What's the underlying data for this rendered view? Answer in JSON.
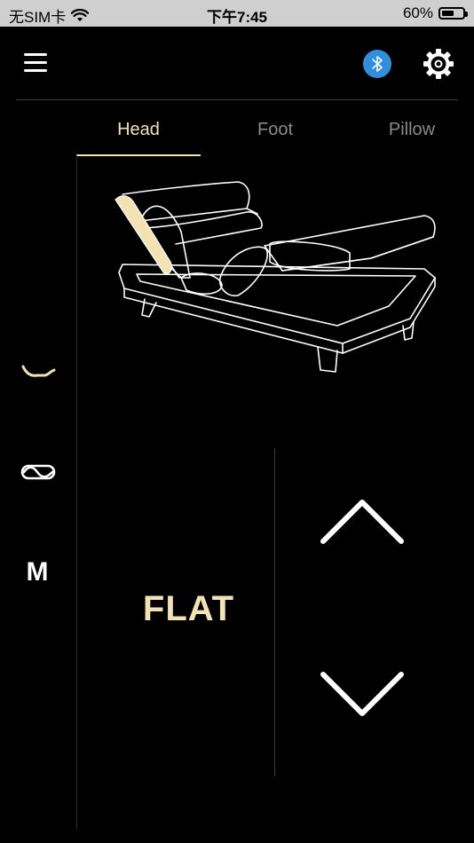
{
  "status_bar": {
    "carrier": "无SIM卡",
    "time": "下午7:45",
    "battery": "60%",
    "battery_level": 0.6
  },
  "header": {
    "menu_icon": "hamburger-icon",
    "bluetooth_icon": "bluetooth-icon",
    "settings_icon": "gear-icon",
    "bluetooth_color": "#2f8fdc"
  },
  "tabs": [
    {
      "label": "Head",
      "active": true
    },
    {
      "label": "Foot",
      "active": false
    },
    {
      "label": "Pillow",
      "active": false
    }
  ],
  "sidebar": {
    "items": [
      {
        "name": "zero-gravity-mode",
        "icon": "bed-curve-icon",
        "active": true
      },
      {
        "name": "massage-wave-mode",
        "icon": "wave-icon",
        "active": false
      },
      {
        "name": "memory-mode",
        "label": "M",
        "active": false
      }
    ]
  },
  "controls": {
    "position_label": "FLAT",
    "up_icon": "chevron-up-icon",
    "down_icon": "chevron-down-icon"
  },
  "colors": {
    "accent": "#f3e2b3",
    "background": "#000000",
    "inactive_text": "#8b8b8b"
  }
}
